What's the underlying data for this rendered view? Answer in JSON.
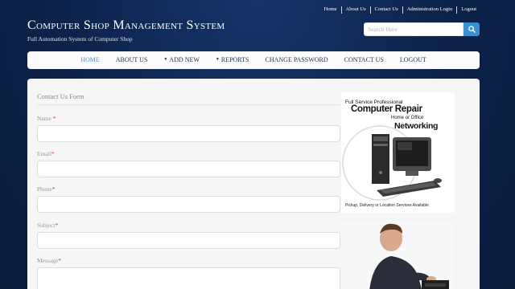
{
  "toplinks": [
    "Home",
    "About Us",
    "Contact Us",
    "Administration Login",
    "Logout"
  ],
  "header": {
    "title": "Computer Shop Management System",
    "subtitle": "Full Automation System of Computer Shop"
  },
  "search": {
    "placeholder": "Search Here",
    "icon": "search-icon"
  },
  "nav": {
    "items": [
      {
        "label": "HOME",
        "active": true,
        "dropdown": false
      },
      {
        "label": "ABOUT US",
        "active": false,
        "dropdown": false
      },
      {
        "label": "ADD NEW",
        "active": false,
        "dropdown": true
      },
      {
        "label": "REPORTS",
        "active": false,
        "dropdown": true
      },
      {
        "label": "CHANGE PASSWORD",
        "active": false,
        "dropdown": false
      },
      {
        "label": "CONTACT US",
        "active": false,
        "dropdown": false
      },
      {
        "label": "LOGOUT",
        "active": false,
        "dropdown": false
      }
    ]
  },
  "form": {
    "title": "Contact Us Form",
    "fields": [
      {
        "label": "Name ",
        "required_mark": "*"
      },
      {
        "label": "Email",
        "required_mark": "*"
      },
      {
        "label": "Phone",
        "required_mark": "*"
      },
      {
        "label": "Subject",
        "required_mark": "*"
      },
      {
        "label": "Message",
        "required_mark": "*"
      }
    ]
  },
  "ad": {
    "line1": "Full Service Professional",
    "line2": "Computer Repair",
    "line3": "Home or Office",
    "line4": "Networking",
    "line5": "Pickup, Delivery or Location Services Available"
  },
  "colors": {
    "background": "#0d2650",
    "nav_active": "#4d8fc9",
    "search_button": "#3a8fd0",
    "required": "#d23b2b"
  }
}
